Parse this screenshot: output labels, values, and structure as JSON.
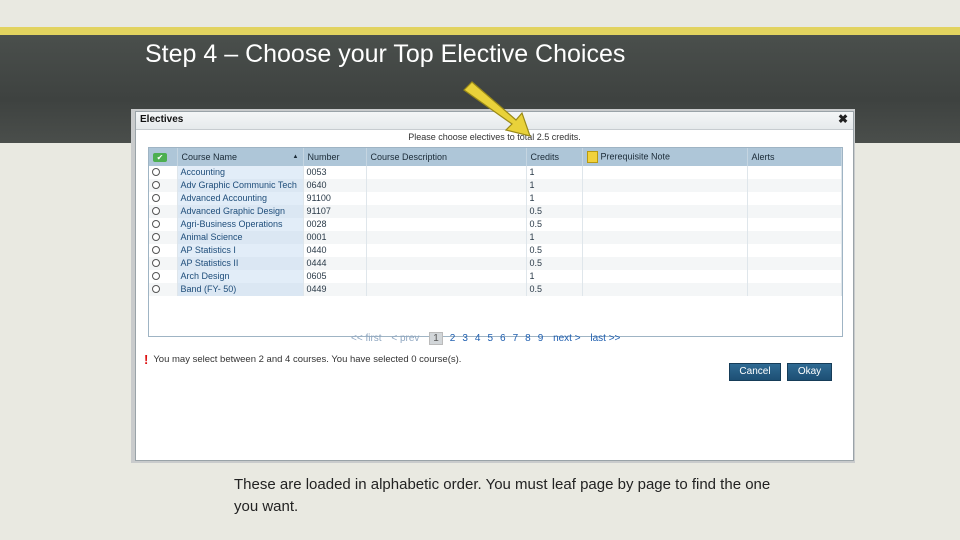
{
  "slide": {
    "title": "Step 4 – Choose your Top Elective Choices",
    "caption": "These are loaded in alphabetic order. You must leaf page by page to find the one you want."
  },
  "dialog": {
    "title": "Electives",
    "close": "✖",
    "instruction": "Please choose electives to total 2.5 credits.",
    "columns": [
      "Course Name",
      "Number",
      "Course Description",
      "Credits",
      "Prerequisite Note",
      "Alerts"
    ],
    "sort_indicator": "▲",
    "rows": [
      {
        "name": "Accounting",
        "number": "0053",
        "credits": "1"
      },
      {
        "name": "Adv Graphic Communic Tech",
        "number": "0640",
        "credits": "1"
      },
      {
        "name": "Advanced Accounting",
        "number": "91100",
        "credits": "1"
      },
      {
        "name": "Advanced Graphic Design",
        "number": "91107",
        "credits": "0.5"
      },
      {
        "name": "Agri-Business Operations",
        "number": "0028",
        "credits": "0.5"
      },
      {
        "name": "Animal Science",
        "number": "0001",
        "credits": "1"
      },
      {
        "name": "AP Statistics I",
        "number": "0440",
        "credits": "0.5"
      },
      {
        "name": "AP Statistics II",
        "number": "0444",
        "credits": "0.5"
      },
      {
        "name": "Arch Design",
        "number": "0605",
        "credits": "1"
      },
      {
        "name": "Band (FY- 50)",
        "number": "0449",
        "credits": "0.5"
      }
    ],
    "pager": {
      "first": "<< first",
      "prev": "< prev",
      "pages": [
        "1",
        "2",
        "3",
        "4",
        "5",
        "6",
        "7",
        "8",
        "9"
      ],
      "current": "1",
      "next": "next >",
      "last": "last >>"
    },
    "alert": "You may select between 2 and 4 courses.  You have selected 0 course(s).",
    "alert_icon": "!",
    "cancel": "Cancel",
    "okay": "Okay"
  },
  "colors": {
    "accent_bar": "#e2d35f",
    "header_band": "#43474a",
    "grid_header": "#aec6d8",
    "button": "#1d4f74"
  },
  "icons": [
    "arrow-pointer-icon",
    "select-all-check-icon",
    "note-icon",
    "close-icon",
    "alert-icon"
  ]
}
